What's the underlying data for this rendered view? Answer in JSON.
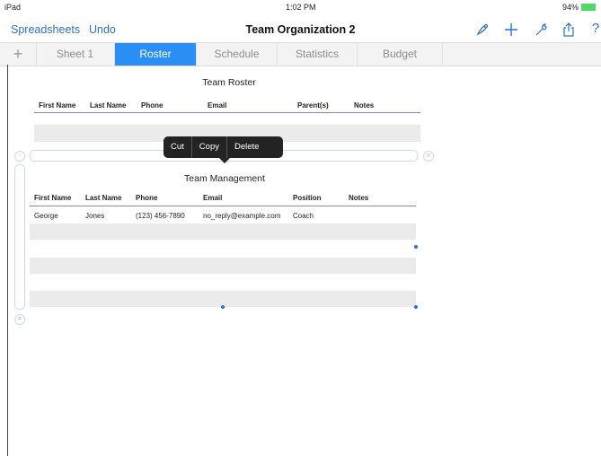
{
  "status": {
    "device": "iPad",
    "time": "1:02 PM",
    "battery": "94%"
  },
  "nav": {
    "spreadsheets": "Spreadsheets",
    "undo": "Undo",
    "title": "Team Organization 2",
    "icons": [
      "paintbrush-icon",
      "plus-icon",
      "wrench-icon",
      "share-icon",
      "help-icon"
    ],
    "help": "?"
  },
  "tabs": [
    {
      "label": "+"
    },
    {
      "label": "Sheet 1"
    },
    {
      "label": "Roster"
    },
    {
      "label": "Schedule"
    },
    {
      "label": "Statistics"
    },
    {
      "label": "Budget"
    }
  ],
  "roster": {
    "title": "Team Roster",
    "headers": [
      "First Name",
      "Last Name",
      "Phone",
      "Email",
      "Parent(s)",
      "Notes"
    ]
  },
  "popup": {
    "cut": "Cut",
    "copy": "Copy",
    "delete": "Delete"
  },
  "management": {
    "title": "Team Management",
    "headers": [
      "First Name",
      "Last Name",
      "Phone",
      "Email",
      "Position",
      "Notes"
    ],
    "rows": [
      {
        "first": "George",
        "last": "Jones",
        "phone": "(123) 456-7890",
        "email": "no_reply@example.com",
        "position": "Coach",
        "notes": ""
      }
    ]
  },
  "colors": {
    "accent": "#2a8ef5",
    "link": "#2a6fd6"
  }
}
